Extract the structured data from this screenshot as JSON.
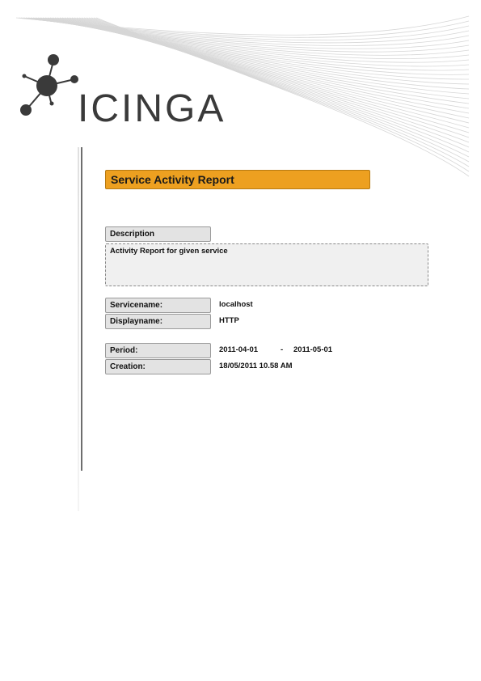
{
  "brand": {
    "name": "ICINGA"
  },
  "report": {
    "title": "Service Activity Report"
  },
  "description": {
    "label": "Description",
    "text": "Activity Report for given service"
  },
  "fields": {
    "servicename": {
      "label": "Servicename:",
      "value": "localhost"
    },
    "displayname": {
      "label": "Displayname:",
      "value": "HTTP"
    },
    "period": {
      "label": "Period:",
      "from": "2011-04-01",
      "separator": "-",
      "to": "2011-05-01"
    },
    "creation": {
      "label": "Creation:",
      "value": "18/05/2011 10.58 AM"
    }
  },
  "colors": {
    "accent": "#eda020",
    "label_bg": "#e3e3e3",
    "logo": "#3a3a3a"
  }
}
